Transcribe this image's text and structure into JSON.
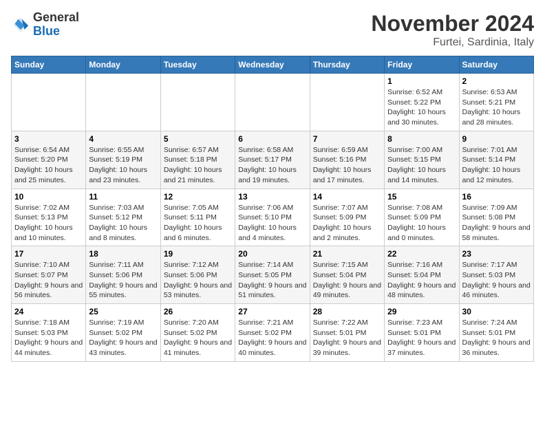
{
  "header": {
    "logo_general": "General",
    "logo_blue": "Blue",
    "month_title": "November 2024",
    "location": "Furtei, Sardinia, Italy"
  },
  "days_of_week": [
    "Sunday",
    "Monday",
    "Tuesday",
    "Wednesday",
    "Thursday",
    "Friday",
    "Saturday"
  ],
  "weeks": [
    [
      {
        "day": "",
        "info": ""
      },
      {
        "day": "",
        "info": ""
      },
      {
        "day": "",
        "info": ""
      },
      {
        "day": "",
        "info": ""
      },
      {
        "day": "",
        "info": ""
      },
      {
        "day": "1",
        "info": "Sunrise: 6:52 AM\nSunset: 5:22 PM\nDaylight: 10 hours and 30 minutes."
      },
      {
        "day": "2",
        "info": "Sunrise: 6:53 AM\nSunset: 5:21 PM\nDaylight: 10 hours and 28 minutes."
      }
    ],
    [
      {
        "day": "3",
        "info": "Sunrise: 6:54 AM\nSunset: 5:20 PM\nDaylight: 10 hours and 25 minutes."
      },
      {
        "day": "4",
        "info": "Sunrise: 6:55 AM\nSunset: 5:19 PM\nDaylight: 10 hours and 23 minutes."
      },
      {
        "day": "5",
        "info": "Sunrise: 6:57 AM\nSunset: 5:18 PM\nDaylight: 10 hours and 21 minutes."
      },
      {
        "day": "6",
        "info": "Sunrise: 6:58 AM\nSunset: 5:17 PM\nDaylight: 10 hours and 19 minutes."
      },
      {
        "day": "7",
        "info": "Sunrise: 6:59 AM\nSunset: 5:16 PM\nDaylight: 10 hours and 17 minutes."
      },
      {
        "day": "8",
        "info": "Sunrise: 7:00 AM\nSunset: 5:15 PM\nDaylight: 10 hours and 14 minutes."
      },
      {
        "day": "9",
        "info": "Sunrise: 7:01 AM\nSunset: 5:14 PM\nDaylight: 10 hours and 12 minutes."
      }
    ],
    [
      {
        "day": "10",
        "info": "Sunrise: 7:02 AM\nSunset: 5:13 PM\nDaylight: 10 hours and 10 minutes."
      },
      {
        "day": "11",
        "info": "Sunrise: 7:03 AM\nSunset: 5:12 PM\nDaylight: 10 hours and 8 minutes."
      },
      {
        "day": "12",
        "info": "Sunrise: 7:05 AM\nSunset: 5:11 PM\nDaylight: 10 hours and 6 minutes."
      },
      {
        "day": "13",
        "info": "Sunrise: 7:06 AM\nSunset: 5:10 PM\nDaylight: 10 hours and 4 minutes."
      },
      {
        "day": "14",
        "info": "Sunrise: 7:07 AM\nSunset: 5:09 PM\nDaylight: 10 hours and 2 minutes."
      },
      {
        "day": "15",
        "info": "Sunrise: 7:08 AM\nSunset: 5:09 PM\nDaylight: 10 hours and 0 minutes."
      },
      {
        "day": "16",
        "info": "Sunrise: 7:09 AM\nSunset: 5:08 PM\nDaylight: 9 hours and 58 minutes."
      }
    ],
    [
      {
        "day": "17",
        "info": "Sunrise: 7:10 AM\nSunset: 5:07 PM\nDaylight: 9 hours and 56 minutes."
      },
      {
        "day": "18",
        "info": "Sunrise: 7:11 AM\nSunset: 5:06 PM\nDaylight: 9 hours and 55 minutes."
      },
      {
        "day": "19",
        "info": "Sunrise: 7:12 AM\nSunset: 5:06 PM\nDaylight: 9 hours and 53 minutes."
      },
      {
        "day": "20",
        "info": "Sunrise: 7:14 AM\nSunset: 5:05 PM\nDaylight: 9 hours and 51 minutes."
      },
      {
        "day": "21",
        "info": "Sunrise: 7:15 AM\nSunset: 5:04 PM\nDaylight: 9 hours and 49 minutes."
      },
      {
        "day": "22",
        "info": "Sunrise: 7:16 AM\nSunset: 5:04 PM\nDaylight: 9 hours and 48 minutes."
      },
      {
        "day": "23",
        "info": "Sunrise: 7:17 AM\nSunset: 5:03 PM\nDaylight: 9 hours and 46 minutes."
      }
    ],
    [
      {
        "day": "24",
        "info": "Sunrise: 7:18 AM\nSunset: 5:03 PM\nDaylight: 9 hours and 44 minutes."
      },
      {
        "day": "25",
        "info": "Sunrise: 7:19 AM\nSunset: 5:02 PM\nDaylight: 9 hours and 43 minutes."
      },
      {
        "day": "26",
        "info": "Sunrise: 7:20 AM\nSunset: 5:02 PM\nDaylight: 9 hours and 41 minutes."
      },
      {
        "day": "27",
        "info": "Sunrise: 7:21 AM\nSunset: 5:02 PM\nDaylight: 9 hours and 40 minutes."
      },
      {
        "day": "28",
        "info": "Sunrise: 7:22 AM\nSunset: 5:01 PM\nDaylight: 9 hours and 39 minutes."
      },
      {
        "day": "29",
        "info": "Sunrise: 7:23 AM\nSunset: 5:01 PM\nDaylight: 9 hours and 37 minutes."
      },
      {
        "day": "30",
        "info": "Sunrise: 7:24 AM\nSunset: 5:01 PM\nDaylight: 9 hours and 36 minutes."
      }
    ]
  ]
}
